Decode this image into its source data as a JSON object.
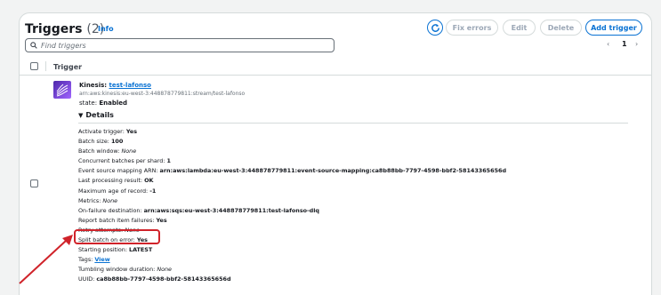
{
  "header": {
    "title": "Triggers",
    "count": "(2)",
    "info": "Info",
    "buttons": {
      "fix_errors": "Fix errors",
      "edit": "Edit",
      "delete": "Delete",
      "add_trigger": "Add trigger"
    }
  },
  "search": {
    "placeholder": "Find triggers"
  },
  "pagination": {
    "prev": "‹",
    "page": "1",
    "next": "›"
  },
  "table": {
    "column": "Trigger"
  },
  "trigger": {
    "type_label": "Kinesis: ",
    "name": "test-lafonso",
    "arn": "arn:aws:kinesis:eu-west-3:448878779811:stream/test-lafonso",
    "state_label": "state: ",
    "state_value": "Enabled",
    "details_label": "Details",
    "details": [
      {
        "k": "Activate trigger: ",
        "v": "Yes",
        "style": "bold"
      },
      {
        "k": "Batch size: ",
        "v": "100",
        "style": "bold"
      },
      {
        "k": "Batch window: ",
        "v": "None",
        "style": "italic"
      },
      {
        "k": "Concurrent batches per shard: ",
        "v": "1",
        "style": "bold"
      },
      {
        "k": "Event source mapping ARN: ",
        "v": "arn:aws:lambda:eu-west-3:448878779811:event-source-mapping:ca8b88bb-7797-4598-bbf2-58143365656d",
        "style": "bold"
      },
      {
        "k": "Last processing result: ",
        "v": "OK",
        "style": "bold"
      },
      {
        "k": "Maximum age of record: ",
        "v": "-1",
        "style": "bold"
      },
      {
        "k": "Metrics: ",
        "v": "None",
        "style": "italic"
      },
      {
        "k": "On-failure destination: ",
        "v": "arn:aws:sqs:eu-west-3:448878779811:test-lafonso-dlq",
        "style": "bold"
      },
      {
        "k": "Report batch item failures: ",
        "v": "Yes",
        "style": "bold"
      },
      {
        "k": "Retry attempts: ",
        "v": "None",
        "style": "italic"
      },
      {
        "k": "Split batch on error: ",
        "v": "Yes",
        "style": "bold"
      },
      {
        "k": "Starting position: ",
        "v": "LATEST",
        "style": "bold"
      },
      {
        "k": "Tags: ",
        "v": "View",
        "style": "link"
      },
      {
        "k": "Tumbling window duration: ",
        "v": "None",
        "style": "italic"
      },
      {
        "k": "UUID: ",
        "v": "ca8b88bb-7797-4598-bbf2-58143365656d",
        "style": "bold"
      }
    ]
  },
  "colors": {
    "accent": "#0972d3",
    "annotation": "#d0232a",
    "kinesis_icon": "#8c4fff"
  },
  "icons": [
    "refresh-icon",
    "search-icon",
    "kinesis-icon",
    "caret-down-icon",
    "arrow-annotation"
  ]
}
